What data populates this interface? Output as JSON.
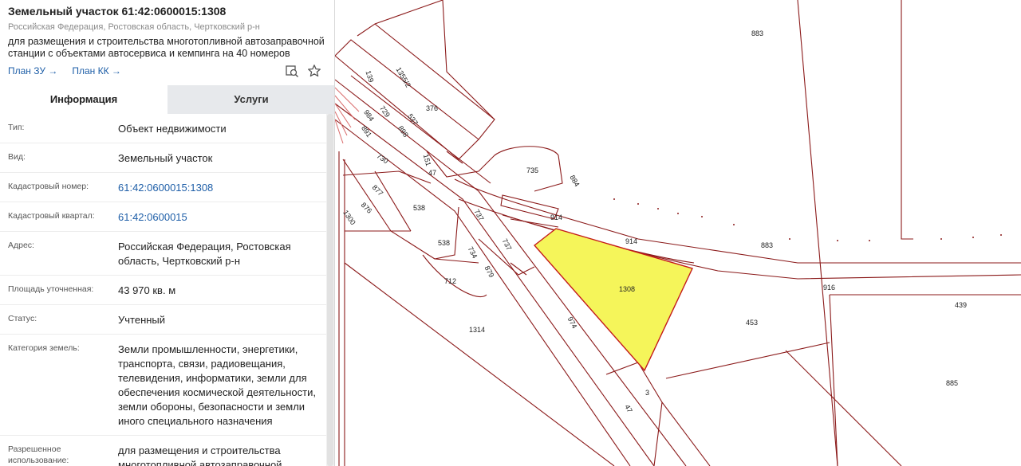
{
  "parcel": {
    "title": "Земельный участок 61:42:0600015:1308",
    "subtitle": "Российская Федерация, Ростовская область, Чертковский р-н",
    "purpose": "для размещения и строительства многотопливной автозаправочной станции с объектами автосервиса и кемпинга на 40 номеров"
  },
  "links": {
    "plan_zu": "План ЗУ →",
    "plan_kk": "План КК →"
  },
  "icons": {
    "search_map": "search-on-map-icon",
    "favorite": "star-icon"
  },
  "tabs": [
    {
      "label": "Информация",
      "active": true
    },
    {
      "label": "Услуги",
      "active": false
    }
  ],
  "info": [
    {
      "key": "Тип:",
      "value": "Объект недвижимости"
    },
    {
      "key": "Вид:",
      "value": "Земельный участок"
    },
    {
      "key": "Кадастровый номер:",
      "value": "61:42:0600015:1308"
    },
    {
      "key": "Кадастровый квартал:",
      "value": "61:42:0600015"
    },
    {
      "key": "Адрес:",
      "value": "Российская Федерация, Ростовская область, Чертковский р-н"
    },
    {
      "key": "Площадь уточненная:",
      "value": "43 970 кв. м"
    },
    {
      "key": "Статус:",
      "value": "Учтенный"
    },
    {
      "key": "Категория земель:",
      "value": "Земли промышленности, энергетики, транспорта, связи, радиовещания, телевидения, информатики, земли для обеспечения космической деятельности, земли обороны, безопасности и земли иного специального назначения"
    },
    {
      "key": "Разрешенное использование:",
      "value": "для размещения и строительства многотопливной автозаправочной"
    }
  ],
  "map_labels": [
    "883",
    "139",
    "1355/2",
    "376",
    "984",
    "729",
    "537",
    "891",
    "898",
    "730",
    "151",
    "47",
    "735",
    "884",
    "877",
    "876",
    "538",
    "1300",
    "737",
    "914",
    "538",
    "734",
    "737",
    "879",
    "712",
    "914",
    "883",
    "1308",
    "916",
    "439",
    "974",
    "453",
    "1314",
    "3",
    "47",
    "885"
  ],
  "colors": {
    "parcel_line": "#8b1a1a",
    "selected_fill": "#f5f55a",
    "link": "#1f5fa8",
    "tab_inactive": "#e7e9ec"
  }
}
